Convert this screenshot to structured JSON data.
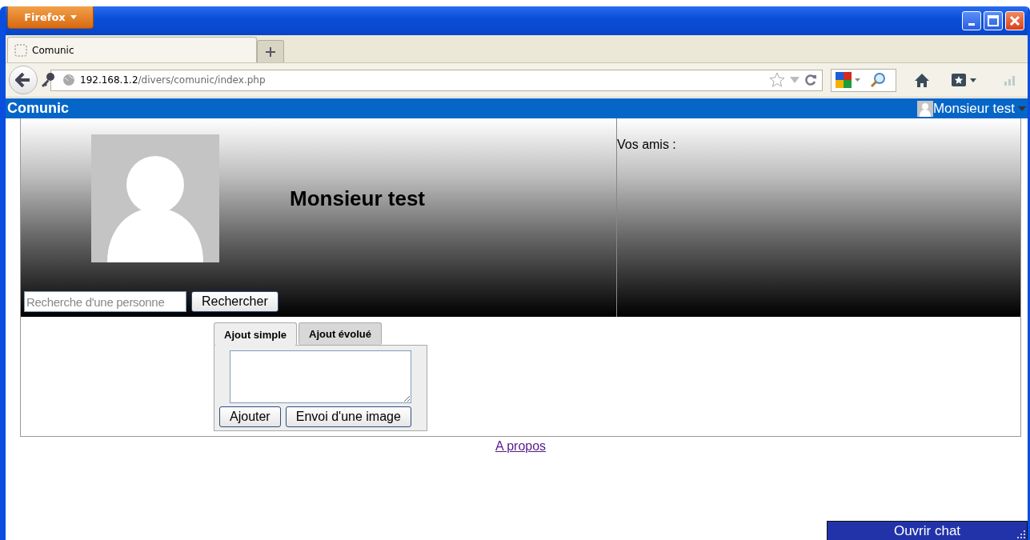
{
  "browser": {
    "menu_button": "Firefox",
    "tabs": [
      {
        "label": "Comunic",
        "selected": true
      }
    ],
    "url": {
      "host": "192.168.1.2",
      "path": "/divers/comunic/index.php"
    }
  },
  "site": {
    "brand": "Comunic",
    "user_menu": "Monsieur test"
  },
  "profile": {
    "name": "Monsieur test",
    "search": {
      "placeholder": "Recherche d'une personne"
    },
    "search_button": "Rechercher",
    "friends_label": "Vos amis :"
  },
  "composer": {
    "tabs": [
      {
        "label": "Ajout simple",
        "selected": true
      },
      {
        "label": "Ajout évolué",
        "selected": false
      }
    ],
    "buttons": [
      "Ajouter",
      "Envoi d'une image"
    ]
  },
  "footer_link": "A propos",
  "chat_button": "Ouvrir chat"
}
